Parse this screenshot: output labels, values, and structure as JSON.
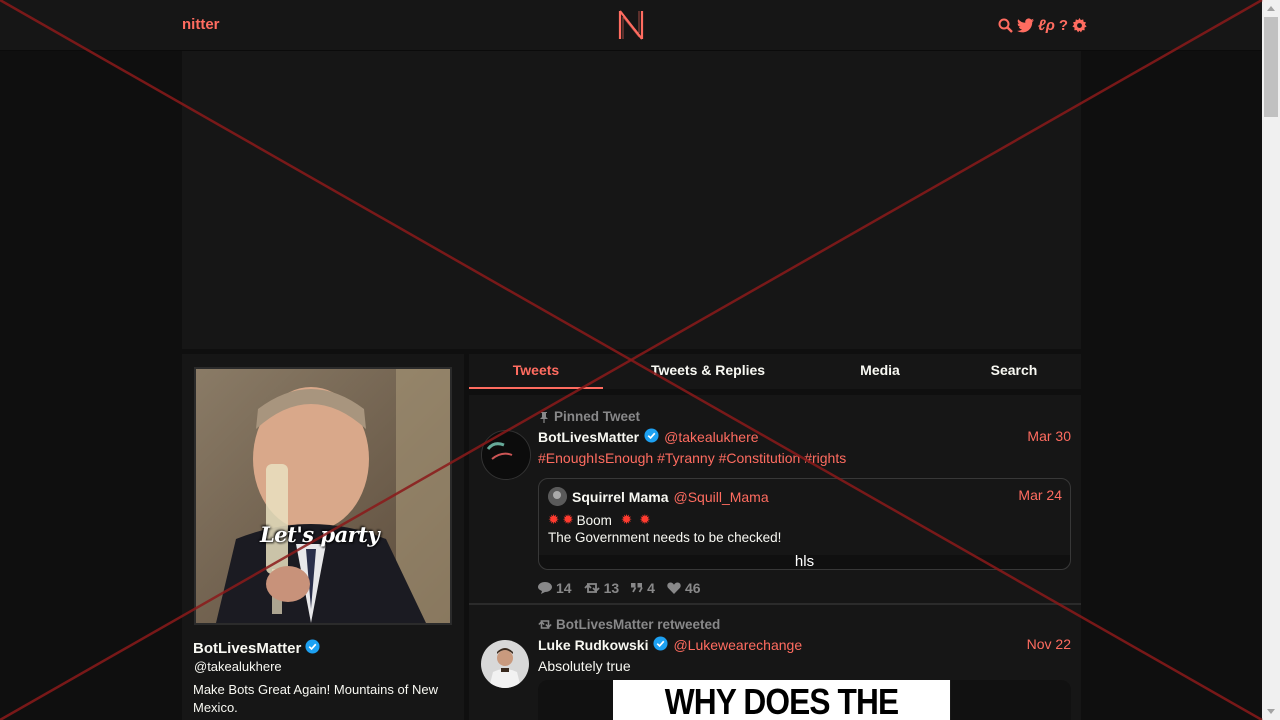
{
  "navbar": {
    "brand": "nitter",
    "logo_letter": "N",
    "icons": [
      "search-icon",
      "twitter-bird-icon",
      "rss-icon",
      "help-icon",
      "settings-gear-icon"
    ],
    "rss_glyph": "ℓρ",
    "help_glyph": "?"
  },
  "profile": {
    "avatar_caption": "Let's party",
    "name": "BotLivesMatter",
    "handle": "@takealukhere",
    "bio": "Make Bots Great Again!  Mountains of New Mexico."
  },
  "tabs": [
    {
      "label": "Tweets",
      "active": true
    },
    {
      "label": "Tweets & Replies",
      "active": false
    },
    {
      "label": "Media",
      "active": false
    },
    {
      "label": "Search",
      "active": false
    }
  ],
  "tweets": [
    {
      "context": "Pinned Tweet",
      "name": "BotLivesMatter",
      "handle": "@takealukhere",
      "date": "Mar 30",
      "hashtags": [
        "#EnoughIsEnough",
        "#Tyranny",
        "#Constitution",
        "#rights"
      ],
      "quote": {
        "name": "Squirrel Mama",
        "handle": "@Squill_Mama",
        "date": "Mar 24",
        "line1_text": "Boom",
        "line2": "The Government needs to be checked!",
        "media_label": "hls"
      },
      "stats": {
        "replies": "14",
        "retweets": "13",
        "quotes": "4",
        "likes": "46"
      }
    },
    {
      "context": "BotLivesMatter retweeted",
      "name": "Luke Rudkowski",
      "handle": "@Lukewearechange",
      "date": "Nov 22",
      "text": "Absolutely true",
      "media_text": "WHY DOES THE MURDER"
    }
  ],
  "colors": {
    "accent": "#ff6c60",
    "background": "#0f0f0f",
    "panel": "#161616",
    "muted": "#888889",
    "verified": "#1da1f2",
    "overlay_cross": "#8b1a1a"
  }
}
